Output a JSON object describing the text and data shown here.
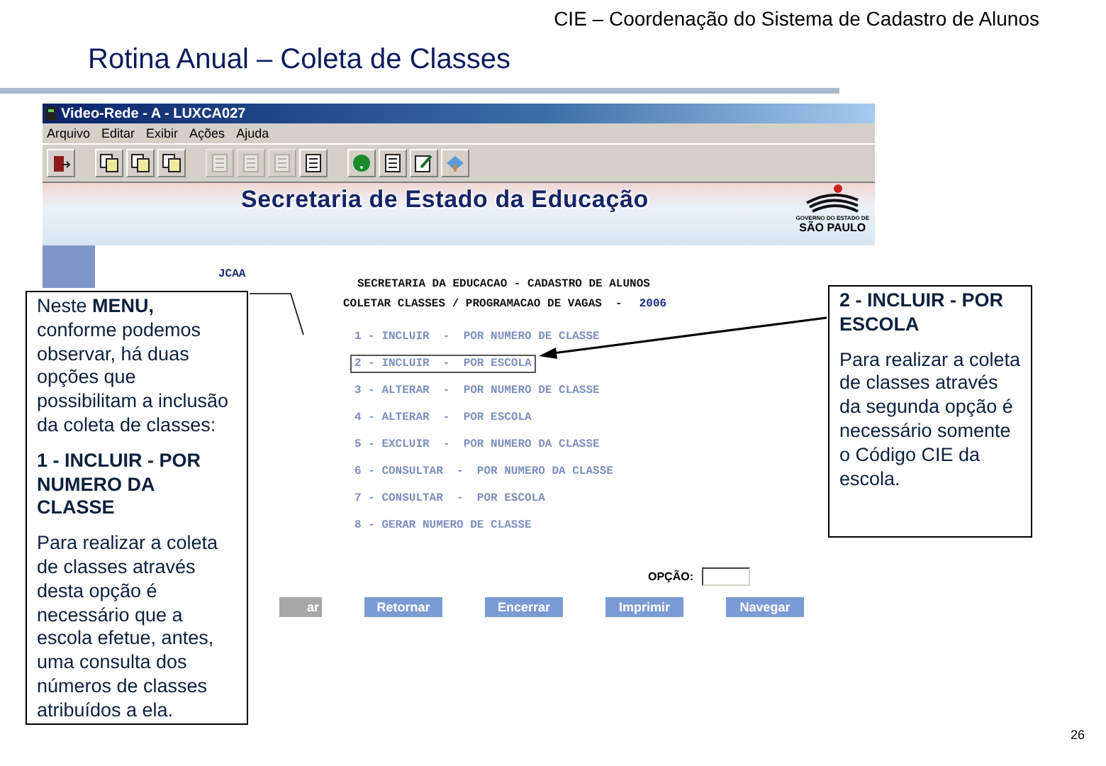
{
  "slide": {
    "header": "CIE – Coordenação do Sistema de Cadastro de Alunos",
    "title": "Rotina Anual – Coleta de Classes",
    "page_number": "26"
  },
  "window": {
    "title": "Video-Rede - A - LUXCA027",
    "menu": [
      "Arquivo",
      "Editar",
      "Exibir",
      "Ações",
      "Ajuda"
    ],
    "toolbar": [
      [
        {
          "disabled": false
        }
      ],
      [
        {
          "disabled": false
        },
        {
          "disabled": false
        },
        {
          "disabled": false
        }
      ],
      [
        {
          "disabled": true
        },
        {
          "disabled": true
        },
        {
          "disabled": true
        },
        {
          "disabled": false
        }
      ],
      [
        {
          "disabled": false
        },
        {
          "disabled": false
        },
        {
          "disabled": false
        },
        {
          "disabled": false
        }
      ]
    ],
    "banner": "Secretaria de Estado da Educação",
    "logo_top": "GOVERNO DO ESTADO DE",
    "logo_caption": "SÃO PAULO"
  },
  "screen": {
    "user": "JCAA",
    "heading": "SECRETARIA DA EDUCACAO - CADASTRO DE ALUNOS",
    "subheading": "COLETAR CLASSES / PROGRAMACAO DE VAGAS  -",
    "year": "2006",
    "options": [
      {
        "label": "1 - INCLUIR  -  POR NUMERO DE CLASSE",
        "selected": false
      },
      {
        "label": "2 - INCLUIR  -  POR ESCOLA",
        "selected": true
      },
      {
        "label": "3 - ALTERAR  -  POR NUMERO DE CLASSE",
        "selected": false
      },
      {
        "label": "4 - ALTERAR  -  POR ESCOLA",
        "selected": false
      },
      {
        "label": "5 - EXCLUIR  -  POR NUMERO DA CLASSE",
        "selected": false
      },
      {
        "label": "6 - CONSULTAR  -  POR NUMERO DA CLASSE",
        "selected": false
      },
      {
        "label": "7 - CONSULTAR  -  POR ESCOLA",
        "selected": false
      },
      {
        "label": "8 - GERAR NUMERO DE CLASSE",
        "selected": false
      }
    ],
    "field_label": "OPÇÃO:",
    "buttons": [
      {
        "label": "ar",
        "disabled": true
      },
      {
        "label": "Retornar",
        "disabled": false
      },
      {
        "label": "Encerrar",
        "disabled": false
      },
      {
        "label": "Imprimir",
        "disabled": false
      },
      {
        "label": "Navegar",
        "disabled": false
      }
    ]
  },
  "callouts": [
    {
      "paragraphs": [
        {
          "kind": "text",
          "text": "Neste **MENU,** conforme podemos observar, há duas opções que possibilitam a inclusão da coleta de classes:"
        },
        {
          "kind": "heading",
          "text": "1 - INCLUIR  -  POR NUMERO DA CLASSE"
        },
        {
          "kind": "body",
          "text": "Para realizar a coleta de classes através desta opção é necessário que a escola efetue, antes, uma consulta dos números de classes atribuídos a ela."
        }
      ]
    },
    {
      "paragraphs": [
        {
          "kind": "heading",
          "text": "2 - INCLUIR  -  POR ESCOLA"
        },
        {
          "kind": "text",
          "text": "Para realizar a coleta de classes através da segunda opção é necessário somente o Código CIE da escola."
        }
      ]
    }
  ]
}
